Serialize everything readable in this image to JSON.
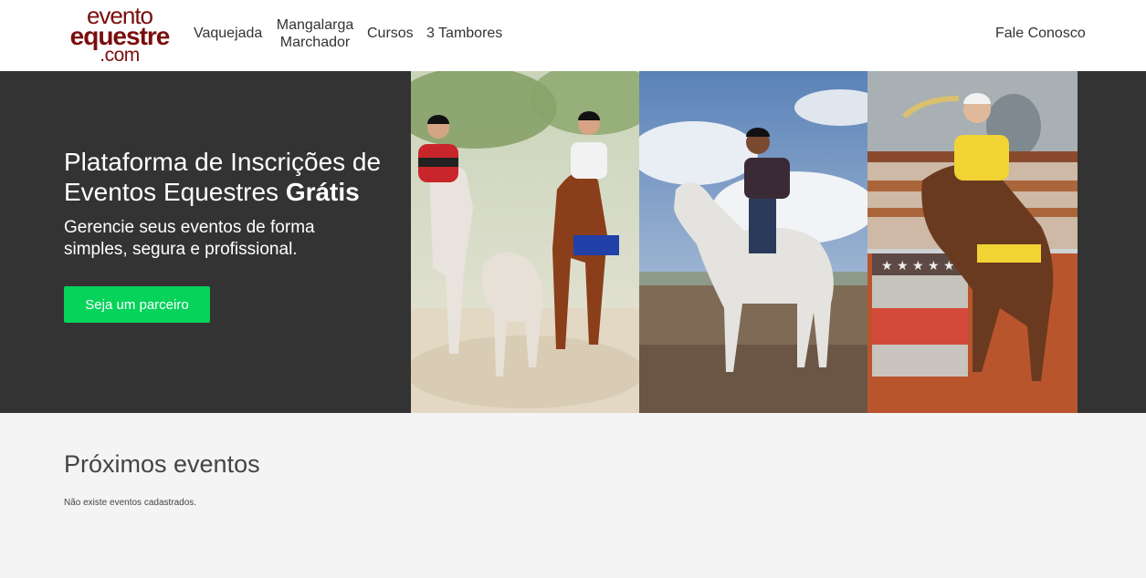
{
  "logo": {
    "line1": "evento",
    "line2": "equestre",
    "line3": ".com",
    "color": "#7a0d0d"
  },
  "nav": {
    "vaquejada": "Vaquejada",
    "mangalarga": "Mangalarga Marchador",
    "cursos": "Cursos",
    "tambores": "3 Tambores",
    "contato": "Fale Conosco"
  },
  "hero": {
    "title_regular": "Plataforma de Inscrições de Eventos Equestres",
    "title_bold": "Grátis",
    "subtitle": "Gerencie seus eventos de forma simples, segura e profissional.",
    "cta_label": "Seja um parceiro",
    "background_color": "#333333",
    "cta_color": "#06d35a"
  },
  "photos": [
    {
      "subject": "vaquejada-riders-photo"
    },
    {
      "subject": "mangalarga-rider-photo"
    },
    {
      "subject": "barrel-racing-photo"
    }
  ],
  "events": {
    "title": "Próximos eventos",
    "empty_message": "Não existe eventos cadastrados."
  }
}
